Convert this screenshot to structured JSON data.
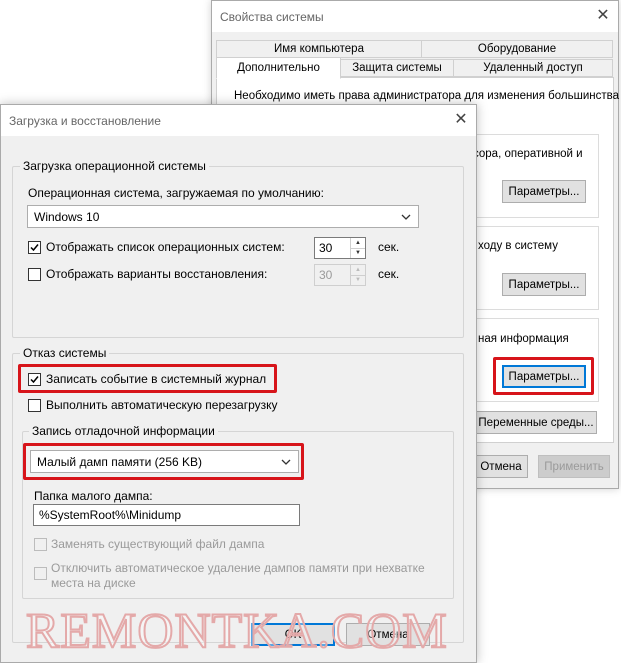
{
  "system_properties": {
    "title": "Свойства системы",
    "tabs_row1": [
      "Имя компьютера",
      "Оборудование"
    ],
    "tabs_row2": [
      "Дополнительно",
      "Защита системы",
      "Удаленный доступ"
    ],
    "admin_note": "Необходимо иметь права администратора для изменения большинства",
    "performance_desc": "сора, оперативной и",
    "profiles_desc": "ходу в систему",
    "startup_desc": "ная информация",
    "params_label": "Параметры...",
    "env_button": "Переменные среды...",
    "cancel_button": "Отмена",
    "apply_button": "Применить"
  },
  "boot_recovery": {
    "title": "Загрузка и восстановление",
    "os_group": {
      "legend": "Загрузка операционной системы",
      "default_os_label": "Операционная система, загружаемая по умолчанию:",
      "default_os_value": "Windows 10",
      "show_os_list_label": "Отображать список операционных систем:",
      "show_os_list_checked": true,
      "show_os_list_seconds": "30",
      "show_recovery_label": "Отображать варианты восстановления:",
      "show_recovery_checked": false,
      "show_recovery_seconds": "30",
      "seconds_unit": "сек."
    },
    "failure_group": {
      "legend": "Отказ системы",
      "write_event_label": "Записать событие в системный журнал",
      "write_event_checked": true,
      "auto_restart_label": "Выполнить автоматическую перезагрузку",
      "auto_restart_checked": false
    },
    "debug_group": {
      "legend": "Запись отладочной информации",
      "dump_type": "Малый дамп памяти (256 KB)",
      "dump_folder_label": "Папка малого дампа:",
      "dump_folder_value": "%SystemRoot%\\Minidump",
      "overwrite_label": "Заменять существующий файл дампа",
      "disable_autodelete_label_line1": "Отключить автоматическое удаление дампов памяти при нехватке",
      "disable_autodelete_label_line2": "места на диске"
    },
    "ok_button": "OK",
    "cancel_button": "Отмена"
  },
  "watermark": "REMONTKA.COM",
  "colors": {
    "highlight": "#d7141a",
    "window_bg": "#f0f0f0",
    "accent": "#0078d7"
  }
}
